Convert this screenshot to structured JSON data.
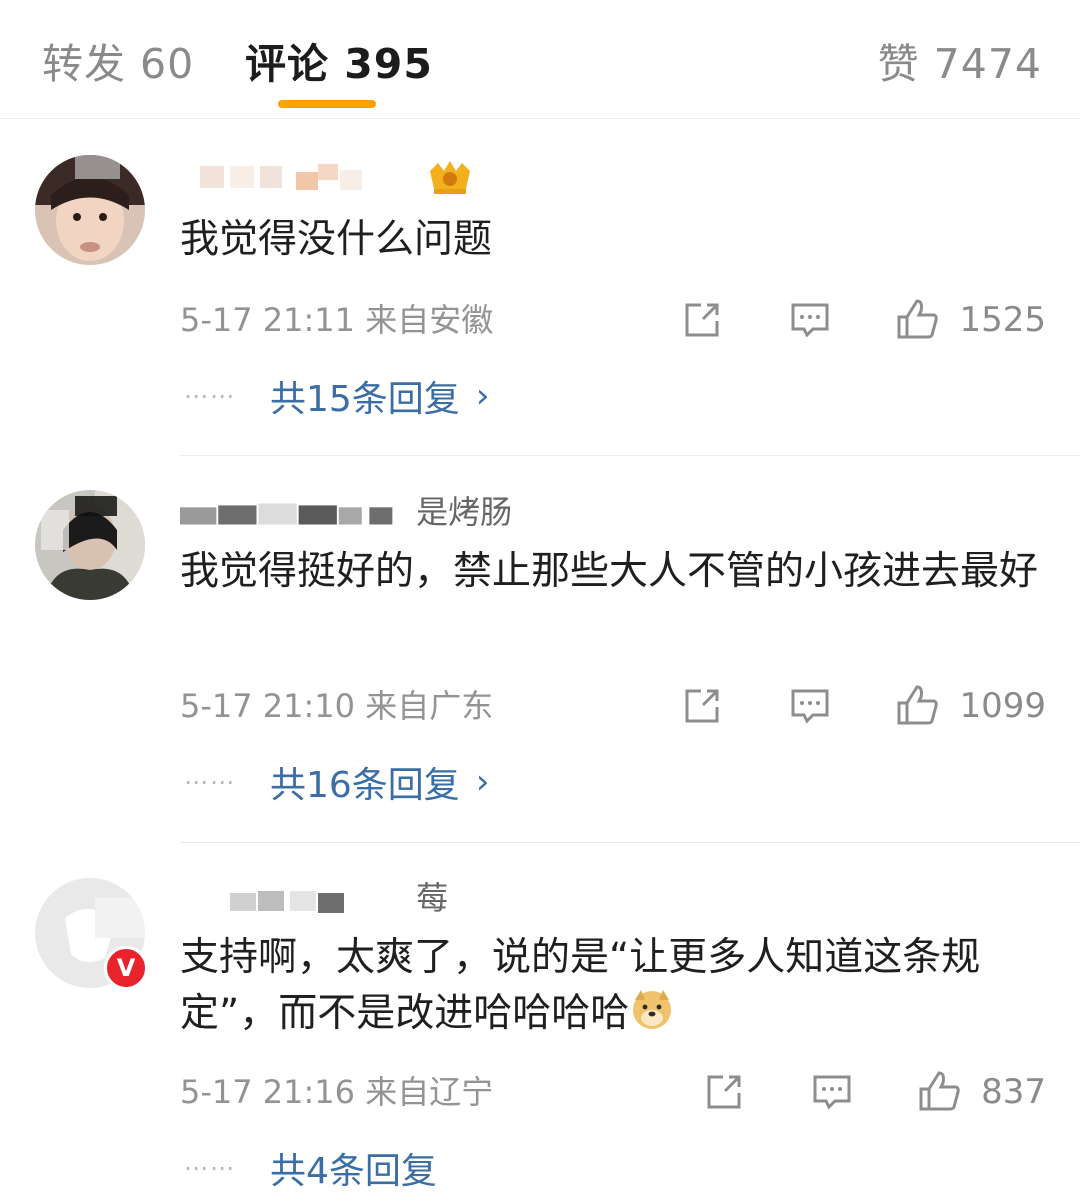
{
  "tabs": {
    "repost": "转发 60",
    "comment": "评论 395",
    "like": "赞 7474"
  },
  "comments": [
    {
      "username_suffix": "",
      "text": "我觉得没什么问题",
      "meta": "5-17 21:11 来自安徽",
      "likes": "1525",
      "replies": "共15条回复"
    },
    {
      "username_suffix": "是烤肠",
      "text": "我觉得挺好的，禁止那些大人不管的小孩进去最好",
      "meta": "5-17 21:10 来自广东",
      "likes": "1099",
      "replies": "共16条回复"
    },
    {
      "username_suffix": "莓",
      "text": "支持啊，太爽了，说的是“让更多人知道这条规定”，而不是改进哈哈哈哈",
      "meta": "5-17 21:16 来自辽宁",
      "likes": "837",
      "replies": "共4条回复",
      "badge": "V"
    }
  ],
  "colors": {
    "accent": "#ffa100",
    "link": "#3a6ea5",
    "verified": "#e8232c"
  }
}
